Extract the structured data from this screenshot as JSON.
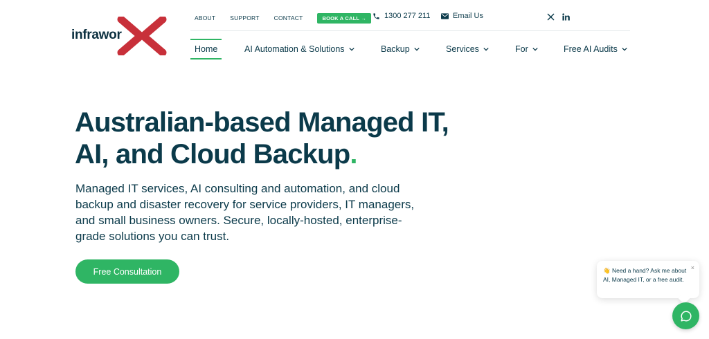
{
  "brand": {
    "name": "infrawor",
    "colors": {
      "accent": "#2fb564",
      "mark": "#c8303a",
      "text": "#0b3a4a"
    }
  },
  "topbar": {
    "links": [
      "ABOUT",
      "SUPPORT",
      "CONTACT"
    ],
    "book_label": "BOOK A CALL →",
    "phone": "1300 277 211",
    "email_label": "Email Us",
    "social": [
      "x-icon",
      "linkedin-icon"
    ]
  },
  "nav": {
    "items": [
      {
        "label": "Home",
        "active": true
      },
      {
        "label": "AI Automation & Solutions"
      },
      {
        "label": "Backup"
      },
      {
        "label": "Services"
      },
      {
        "label": "For"
      },
      {
        "label": "Free AI Audits"
      }
    ]
  },
  "hero": {
    "title_line1": "Australian-based Managed IT,",
    "title_line2": "AI, and Cloud Backup",
    "title_dot": ".",
    "subtitle": "Managed IT services, AI consulting and automation, and cloud backup and disaster recovery for service providers, IT managers, and small business owners. Secure, locally-hosted, enterprise-grade solutions you can trust.",
    "cta_label": "Free Consultation"
  },
  "chat": {
    "emoji": "👋",
    "message": "Need a hand? Ask me about AI, Managed IT, or a free audit.",
    "close": "×"
  }
}
